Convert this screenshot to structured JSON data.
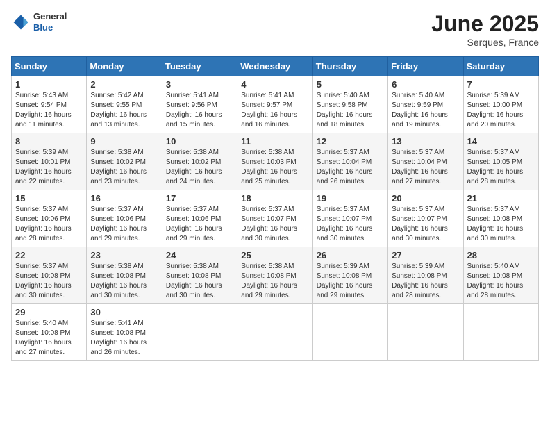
{
  "header": {
    "logo_general": "General",
    "logo_blue": "Blue",
    "month": "June 2025",
    "location": "Serques, France"
  },
  "columns": [
    "Sunday",
    "Monday",
    "Tuesday",
    "Wednesday",
    "Thursday",
    "Friday",
    "Saturday"
  ],
  "weeks": [
    [
      {
        "day": "1",
        "info": "Sunrise: 5:43 AM\nSunset: 9:54 PM\nDaylight: 16 hours\nand 11 minutes."
      },
      {
        "day": "2",
        "info": "Sunrise: 5:42 AM\nSunset: 9:55 PM\nDaylight: 16 hours\nand 13 minutes."
      },
      {
        "day": "3",
        "info": "Sunrise: 5:41 AM\nSunset: 9:56 PM\nDaylight: 16 hours\nand 15 minutes."
      },
      {
        "day": "4",
        "info": "Sunrise: 5:41 AM\nSunset: 9:57 PM\nDaylight: 16 hours\nand 16 minutes."
      },
      {
        "day": "5",
        "info": "Sunrise: 5:40 AM\nSunset: 9:58 PM\nDaylight: 16 hours\nand 18 minutes."
      },
      {
        "day": "6",
        "info": "Sunrise: 5:40 AM\nSunset: 9:59 PM\nDaylight: 16 hours\nand 19 minutes."
      },
      {
        "day": "7",
        "info": "Sunrise: 5:39 AM\nSunset: 10:00 PM\nDaylight: 16 hours\nand 20 minutes."
      }
    ],
    [
      {
        "day": "8",
        "info": "Sunrise: 5:39 AM\nSunset: 10:01 PM\nDaylight: 16 hours\nand 22 minutes."
      },
      {
        "day": "9",
        "info": "Sunrise: 5:38 AM\nSunset: 10:02 PM\nDaylight: 16 hours\nand 23 minutes."
      },
      {
        "day": "10",
        "info": "Sunrise: 5:38 AM\nSunset: 10:02 PM\nDaylight: 16 hours\nand 24 minutes."
      },
      {
        "day": "11",
        "info": "Sunrise: 5:38 AM\nSunset: 10:03 PM\nDaylight: 16 hours\nand 25 minutes."
      },
      {
        "day": "12",
        "info": "Sunrise: 5:37 AM\nSunset: 10:04 PM\nDaylight: 16 hours\nand 26 minutes."
      },
      {
        "day": "13",
        "info": "Sunrise: 5:37 AM\nSunset: 10:04 PM\nDaylight: 16 hours\nand 27 minutes."
      },
      {
        "day": "14",
        "info": "Sunrise: 5:37 AM\nSunset: 10:05 PM\nDaylight: 16 hours\nand 28 minutes."
      }
    ],
    [
      {
        "day": "15",
        "info": "Sunrise: 5:37 AM\nSunset: 10:06 PM\nDaylight: 16 hours\nand 28 minutes."
      },
      {
        "day": "16",
        "info": "Sunrise: 5:37 AM\nSunset: 10:06 PM\nDaylight: 16 hours\nand 29 minutes."
      },
      {
        "day": "17",
        "info": "Sunrise: 5:37 AM\nSunset: 10:06 PM\nDaylight: 16 hours\nand 29 minutes."
      },
      {
        "day": "18",
        "info": "Sunrise: 5:37 AM\nSunset: 10:07 PM\nDaylight: 16 hours\nand 30 minutes."
      },
      {
        "day": "19",
        "info": "Sunrise: 5:37 AM\nSunset: 10:07 PM\nDaylight: 16 hours\nand 30 minutes."
      },
      {
        "day": "20",
        "info": "Sunrise: 5:37 AM\nSunset: 10:07 PM\nDaylight: 16 hours\nand 30 minutes."
      },
      {
        "day": "21",
        "info": "Sunrise: 5:37 AM\nSunset: 10:08 PM\nDaylight: 16 hours\nand 30 minutes."
      }
    ],
    [
      {
        "day": "22",
        "info": "Sunrise: 5:37 AM\nSunset: 10:08 PM\nDaylight: 16 hours\nand 30 minutes."
      },
      {
        "day": "23",
        "info": "Sunrise: 5:38 AM\nSunset: 10:08 PM\nDaylight: 16 hours\nand 30 minutes."
      },
      {
        "day": "24",
        "info": "Sunrise: 5:38 AM\nSunset: 10:08 PM\nDaylight: 16 hours\nand 30 minutes."
      },
      {
        "day": "25",
        "info": "Sunrise: 5:38 AM\nSunset: 10:08 PM\nDaylight: 16 hours\nand 29 minutes."
      },
      {
        "day": "26",
        "info": "Sunrise: 5:39 AM\nSunset: 10:08 PM\nDaylight: 16 hours\nand 29 minutes."
      },
      {
        "day": "27",
        "info": "Sunrise: 5:39 AM\nSunset: 10:08 PM\nDaylight: 16 hours\nand 28 minutes."
      },
      {
        "day": "28",
        "info": "Sunrise: 5:40 AM\nSunset: 10:08 PM\nDaylight: 16 hours\nand 28 minutes."
      }
    ],
    [
      {
        "day": "29",
        "info": "Sunrise: 5:40 AM\nSunset: 10:08 PM\nDaylight: 16 hours\nand 27 minutes."
      },
      {
        "day": "30",
        "info": "Sunrise: 5:41 AM\nSunset: 10:08 PM\nDaylight: 16 hours\nand 26 minutes."
      },
      null,
      null,
      null,
      null,
      null
    ]
  ]
}
